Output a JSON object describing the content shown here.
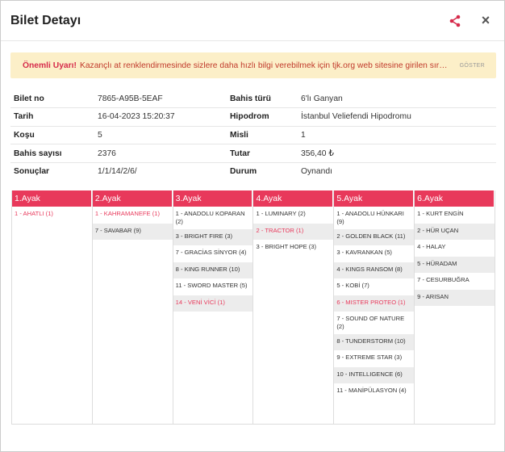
{
  "header": {
    "title": "Bilet Detayı",
    "share_icon": "share-icon",
    "close_label": "×"
  },
  "warning": {
    "title": "Önemli Uyarı!",
    "text": "Kazançlı at renklendirmesinde sizlere daha hızlı bilgi verebilmek için tjk.org web sitesine girilen sıral...",
    "button": "GÖSTER"
  },
  "info": [
    {
      "l1": "Bilet no",
      "v1": "7865-A95B-5EAF",
      "l2": "Bahis türü",
      "v2": "6'lı Ganyan"
    },
    {
      "l1": "Tarih",
      "v1": "16-04-2023 15:20:37",
      "l2": "Hipodrom",
      "v2": "İstanbul Veliefendi Hipodromu"
    },
    {
      "l1": "Koşu",
      "v1": "5",
      "l2": "Misli",
      "v2": "1"
    },
    {
      "l1": "Bahis sayısı",
      "v1": "2376",
      "l2": "Tutar",
      "v2": "356,40 ₺"
    },
    {
      "l1": "Sonuçlar",
      "v1": "1/1/14/2/6/",
      "l2": "Durum",
      "v2": "Oynandı"
    }
  ],
  "colors": {
    "accent": "#e8395b",
    "warning_bg": "#fcefc8",
    "winner": "#e8395b"
  },
  "legs": [
    {
      "title": "1.Ayak",
      "horses": [
        {
          "name": "1 - AHATLI (1)",
          "win": true
        }
      ]
    },
    {
      "title": "2.Ayak",
      "horses": [
        {
          "name": "1 - KAHRAMANEFE (1)",
          "win": true
        },
        {
          "name": "7 - SAVABAR (9)",
          "win": false
        }
      ]
    },
    {
      "title": "3.Ayak",
      "horses": [
        {
          "name": "1 - ANADOLU KOPARAN (2)",
          "win": false
        },
        {
          "name": "3 - BRIGHT FIRE (3)",
          "win": false
        },
        {
          "name": "7 - GRACİAS SİNYOR (4)",
          "win": false
        },
        {
          "name": "8 - KING RUNNER (10)",
          "win": false
        },
        {
          "name": "11 - SWORD MASTER (5)",
          "win": false
        },
        {
          "name": "14 - VENİ VİCİ (1)",
          "win": true
        }
      ]
    },
    {
      "title": "4.Ayak",
      "horses": [
        {
          "name": "1 - LUMINARY (2)",
          "win": false
        },
        {
          "name": "2 - TRACTOR (1)",
          "win": true
        },
        {
          "name": "3 - BRIGHT HOPE (3)",
          "win": false
        }
      ]
    },
    {
      "title": "5.Ayak",
      "horses": [
        {
          "name": "1 - ANADOLU HÜNKARI (9)",
          "win": false
        },
        {
          "name": "2 - GOLDEN BLACK (11)",
          "win": false
        },
        {
          "name": "3 - KAVRANKAN (5)",
          "win": false
        },
        {
          "name": "4 - KINGS RANSOM (8)",
          "win": false
        },
        {
          "name": "5 - KOBİ (7)",
          "win": false
        },
        {
          "name": "6 - MISTER PROTEO (1)",
          "win": true
        },
        {
          "name": "7 - SOUND OF NATURE (2)",
          "win": false
        },
        {
          "name": "8 - TUNDERSTORM (10)",
          "win": false
        },
        {
          "name": "9 - EXTREME STAR (3)",
          "win": false
        },
        {
          "name": "10 - INTELLIGENCE (6)",
          "win": false
        },
        {
          "name": "11 - MANİPÜLASYON (4)",
          "win": false
        }
      ]
    },
    {
      "title": "6.Ayak",
      "horses": [
        {
          "name": "1 - KURT ENGİN",
          "win": false
        },
        {
          "name": "2 - HÜR UÇAN",
          "win": false
        },
        {
          "name": "4 - HALAY",
          "win": false
        },
        {
          "name": "5 - HÜRADAM",
          "win": false
        },
        {
          "name": "7 - CESURBUĞRA",
          "win": false
        },
        {
          "name": "9 - ARISAN",
          "win": false
        }
      ]
    }
  ]
}
